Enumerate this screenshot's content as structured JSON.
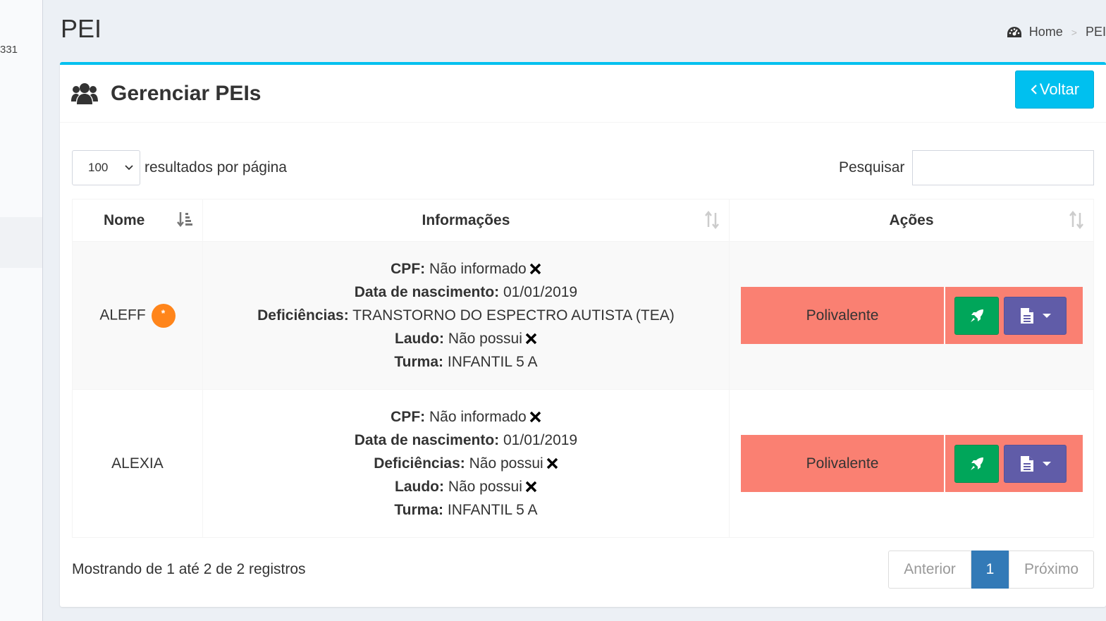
{
  "sidebar": {
    "snippet": "331"
  },
  "header": {
    "title": "PEI",
    "breadcrumb": {
      "home": "Home",
      "separator": ">",
      "current": "PEI"
    }
  },
  "box": {
    "title": "Gerenciar PEIs",
    "back_button": "Voltar",
    "accent_color": "#00c0ef"
  },
  "controls": {
    "page_length_value": "100",
    "page_length_label": "resultados por página",
    "search_label": "Pesquisar",
    "search_value": ""
  },
  "table": {
    "columns": [
      "Nome",
      "Informações",
      "Ações"
    ],
    "labels": {
      "cpf": "CPF:",
      "birth": "Data de nascimento:",
      "disabilities": "Deficiências:",
      "report": "Laudo:",
      "class": "Turma:"
    },
    "rows": [
      {
        "name": "ALEFF",
        "badge": "*",
        "cpf": "Não informado",
        "birth": "01/01/2019",
        "disabilities": "TRANSTORNO DO ESPECTRO AUTISTA (TEA)",
        "report": "Não possui",
        "class": "INFANTIL 5 A",
        "teacher_type": "Polivalente"
      },
      {
        "name": "ALEXIA",
        "cpf": "Não informado",
        "birth": "01/01/2019",
        "disabilities": "Não possui",
        "report": "Não possui",
        "class": "INFANTIL 5 A",
        "teacher_type": "Polivalente"
      }
    ]
  },
  "footer": {
    "info": "Mostrando de 1 até 2 de 2 registros",
    "pagination": {
      "previous": "Anterior",
      "current": "1",
      "next": "Próximo"
    }
  },
  "colors": {
    "action_bg": "#fa8072",
    "rocket_button": "#00a65a",
    "doc_button": "#605ca8",
    "active_page": "#337ab7",
    "badge": "#ff851b"
  }
}
